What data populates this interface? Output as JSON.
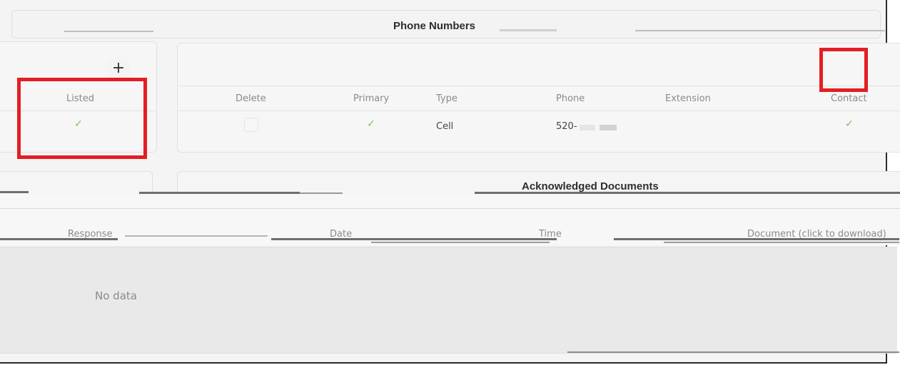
{
  "phone_numbers": {
    "title": "Phone Numbers",
    "add_button_label": "+",
    "headers": {
      "listed": "Listed",
      "delete": "Delete",
      "primary": "Primary",
      "type": "Type",
      "phone": "Phone",
      "extension": "Extension",
      "contact": "Contact"
    },
    "rows": [
      {
        "listed": "✓",
        "delete": "",
        "primary": "✓",
        "type": "Cell",
        "phone": "520-",
        "extension": "",
        "contact": "✓"
      }
    ]
  },
  "acknowledged_documents": {
    "title": "Acknowledged Documents",
    "headers": {
      "response": "Response",
      "date": "Date",
      "time": "Time",
      "document": "Document (click to download)"
    },
    "empty_text": "No data"
  },
  "colors": {
    "highlight": "#e31e24",
    "check": "#7cbf5a"
  }
}
